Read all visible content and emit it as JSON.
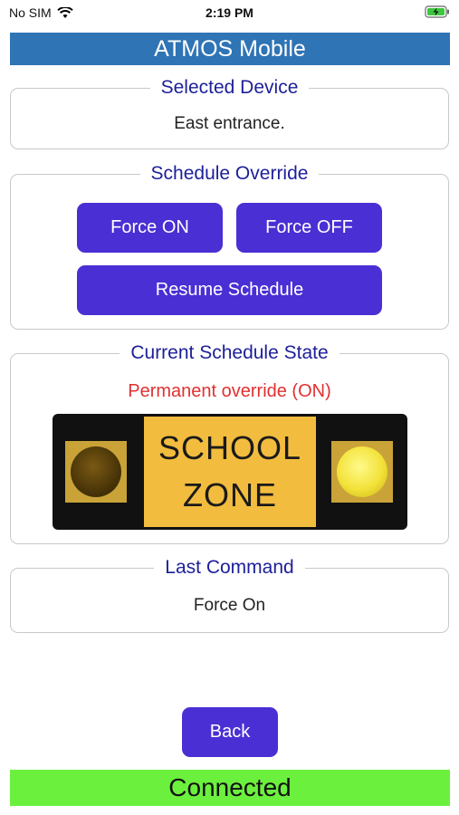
{
  "status_bar": {
    "carrier": "No SIM",
    "time": "2:19 PM"
  },
  "header": {
    "title": "ATMOS Mobile",
    "color": "#2f74b5"
  },
  "selected_device": {
    "legend": "Selected Device",
    "value": "East entrance."
  },
  "schedule_override": {
    "legend": "Schedule Override",
    "force_on": "Force ON",
    "force_off": "Force OFF",
    "resume": "Resume Schedule",
    "button_color": "#4a2fd4"
  },
  "current_state": {
    "legend": "Current Schedule State",
    "status": "Permanent override (ON)",
    "status_color": "#e03131",
    "sign_line1": "SCHOOL",
    "sign_line2": "ZONE",
    "left_lamp": "off",
    "right_lamp": "on"
  },
  "last_command": {
    "legend": "Last Command",
    "value": "Force On"
  },
  "back_label": "Back",
  "connection": {
    "status": "Connected",
    "color": "#6cf03e"
  }
}
